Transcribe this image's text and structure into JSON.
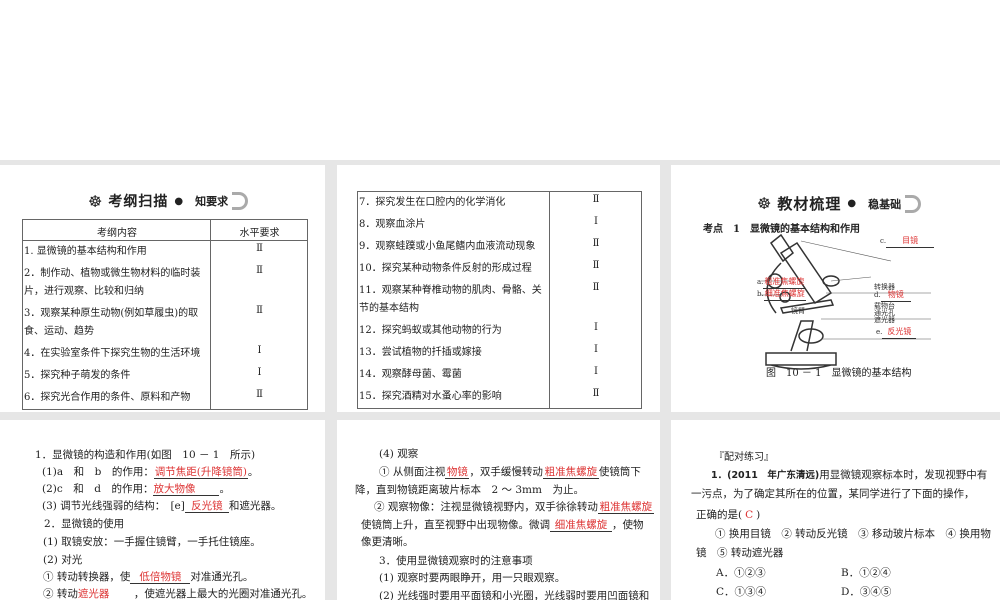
{
  "panel1": {
    "banner_title": "考纲扫描",
    "banner_sub": "知要求",
    "header": [
      "考纲内容",
      "水平要求"
    ],
    "rows": [
      {
        "text": [
          "1. 显微镜的基本结构和作用"
        ],
        "level": "Ⅱ"
      },
      {
        "text": [
          "2．制作动、植物或微生物材料的临时装",
          "片，进行观察、比较和归纳"
        ],
        "level": "Ⅱ"
      },
      {
        "text": [
          "3．观察某种原生动物(例如草履虫)的取",
          "食、运动、趋势"
        ],
        "level": "Ⅱ"
      },
      {
        "text": [
          "4．在实验室条件下探究生物的生活环境"
        ],
        "level": "Ⅰ"
      },
      {
        "text": [
          "5．探究种子萌发的条件"
        ],
        "level": "Ⅰ"
      },
      {
        "text": [
          "6．探究光合作用的条件、原料和产物"
        ],
        "level": "Ⅱ"
      }
    ]
  },
  "panel2": {
    "rows": [
      {
        "text": [
          "7．探究发生在口腔内的化学消化"
        ],
        "level": "Ⅱ"
      },
      {
        "text": [
          "8．观察血涂片"
        ],
        "level": "Ⅰ"
      },
      {
        "text": [
          "9．观察蛙蹼或小鱼尾鳍内血液流动现象"
        ],
        "level": "Ⅱ"
      },
      {
        "text": [
          "10．探究某种动物条件反射的形成过程"
        ],
        "level": "Ⅱ"
      },
      {
        "text": [
          "11．观察某种脊椎动物的肌肉、骨骼、关",
          "节的基本结构"
        ],
        "level": "Ⅱ"
      },
      {
        "text": [
          "12．探究蚂蚁或其他动物的行为"
        ],
        "level": "Ⅰ"
      },
      {
        "text": [
          "13．尝试植物的扦插或嫁接"
        ],
        "level": "Ⅰ"
      },
      {
        "text": [
          "14．观察酵母菌、霉菌"
        ],
        "level": "Ⅰ"
      },
      {
        "text": [
          "15．探究酒精对水蚤心率的影响"
        ],
        "level": "Ⅱ"
      }
    ]
  },
  "panel3": {
    "banner_title": "教材梳理",
    "banner_sub": "稳基础",
    "point": "考点　1　显微镜的基本结构和作用",
    "labels": {
      "a": "粗准焦螺旋",
      "b": "细准焦螺旋",
      "c": "目镜",
      "d": "物镜",
      "e": "反光镜",
      "arm": "镜臂",
      "nosepiece": "转换器",
      "stage": "载物台",
      "hole": "通光孔",
      "diaphragm": "遮光器",
      "la": "a.",
      "lb": "b.",
      "lc": "c.",
      "ld": "d.",
      "le": "e."
    },
    "caption": "图　10 － 1　显微镜的基本结构"
  },
  "panel4": {
    "l1": "1．显微镜的构造和作用(如图　10 － 1　所示)",
    "l2a": "(1)a　和　b　的作用：",
    "l2b": "调节焦距(升降镜筒)",
    "l2c": "。",
    "l3a": "(2)c　和　d　的作用：",
    "l3b": "放大物像",
    "l3c": "。",
    "l4a": "(3) 调节光线强弱的结构：　[e]",
    "l4b": "反光镜",
    "l4c": "和遮光器。",
    "l5": "2．显微镜的使用",
    "l6": "(1) 取镜安放：一手握住镜臂，一手托住镜座。",
    "l7": "(2) 对光",
    "l8a": "① 转动转换器，使",
    "l8b": "低倍物镜",
    "l8c": "对准通光孔。",
    "l9a": "② 转动",
    "l9b": "遮光器",
    "l9c": "，使遮光器上最大的光圈对准通光孔。"
  },
  "panel5": {
    "l1": "(4) 观察",
    "l2a": "① 从侧面注视",
    "l2b": "物镜",
    "l2c": "，双手缓慢转动",
    "l2d": "粗准焦螺旋",
    "l2e": "使镜筒下",
    "l3": "降，直到物镜距离玻片标本　2 ～ 3mm　为止。",
    "l4a": "② 观察物像：注视显微镜视野内，双手徐徐转动",
    "l4b": "粗准焦螺旋",
    "l5a": "使镜筒上升，直至视野中出现物像。微调",
    "l5b": "细准焦螺旋",
    "l5c": "，使物",
    "l6": "像更清晰。",
    "l7": "3．使用显微镜观察时的注意事项",
    "l8": "(1) 观察时要两眼睁开，用一只眼观察。",
    "l9": "(2) 光线强时要用平面镜和小光圈，光线弱时要用凹面镜和"
  },
  "panel6": {
    "title": "『配对练习』",
    "q1a": "1．(2011　年广东清远)",
    "q1b": "用显微镜观察标本时，发现视野中有",
    "q2": "一污点，为了确定其所在的位置，某同学进行了下面的操作，",
    "q3a": "正确的是(",
    "q3b": "C",
    "q3c": ")",
    "q4": "① 换用目镜　② 转动反光镜　③ 移动玻片标本　④ 换用物",
    "q5": "镜　⑤ 转动遮光器",
    "A": "A．①②③",
    "B": "B．①②④",
    "C": "C．①③④",
    "D": "D．③④⑤"
  }
}
